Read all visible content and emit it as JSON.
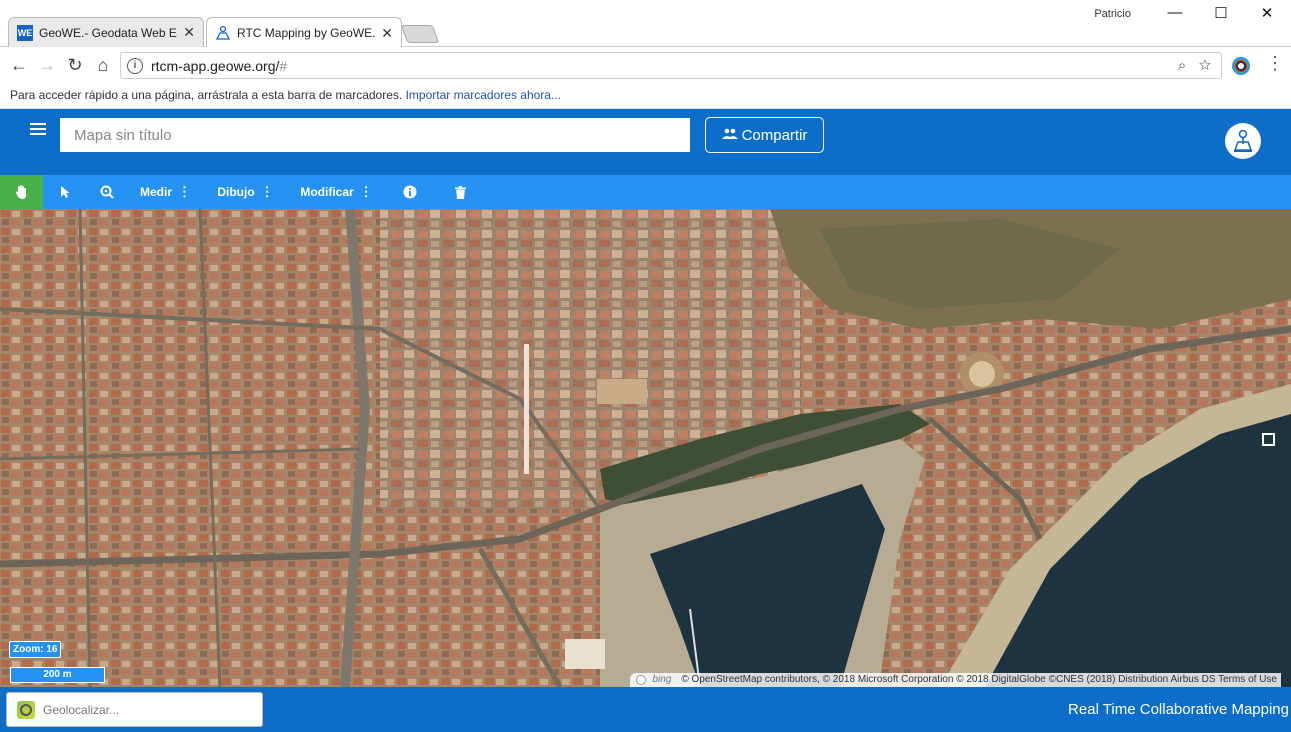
{
  "browser": {
    "tabs": [
      {
        "label": "GeoWE.- Geodata Web E",
        "favicon_text": "WE"
      },
      {
        "label": "RTC Mapping by GeoWE.",
        "favicon_text": ""
      }
    ],
    "user": "Patricio",
    "url_main": "rtcm-app.geowe.org/",
    "url_hash": "#",
    "bookmark_hint": "Para acceder rápido a una página, arrástrala a esta barra de marcadores.",
    "bookmark_link": "Importar marcadores ahora..."
  },
  "header": {
    "title_placeholder": "Mapa sin título",
    "share_label": "Compartir"
  },
  "toolbar": {
    "measure_label": "Medir",
    "draw_label": "Dibujo",
    "modify_label": "Modificar"
  },
  "map": {
    "zoom_label": "Zoom: 16",
    "scale_label": "200 m",
    "attribution_bing": "bing",
    "attribution_text": "© OpenStreetMap contributors, © 2018 Microsoft Corporation © 2018 DigitalGlobe ©CNES (2018) Distribution Airbus DS Terms of Use"
  },
  "footer": {
    "geolocate_placeholder": "Geolocalizar...",
    "brand": "Real Time Collaborative Mapping"
  },
  "colors": {
    "header_blue": "#0d6ec9",
    "toolbar_blue": "#2591f0",
    "active_tool_green": "#49b049",
    "sea": "#1d3340"
  },
  "icons": [
    "hand-pan-icon",
    "pointer-icon",
    "zoom-search-icon",
    "info-icon",
    "trash-icon",
    "hamburger-icon",
    "people-icon",
    "geolocate-icon",
    "fullscreen-icon"
  ]
}
